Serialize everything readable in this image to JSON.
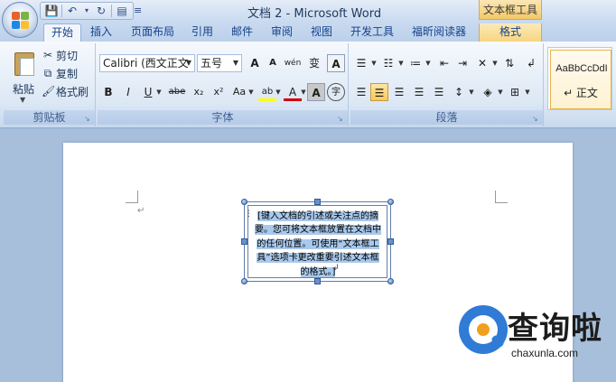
{
  "window": {
    "title": "文档 2 - Microsoft Word",
    "context_tool_title": "文本框工具"
  },
  "quick_access": {
    "save_icon": "save-icon",
    "undo_icon": "undo-icon",
    "redo_icon": "redo-icon",
    "print_icon": "print-preview-icon",
    "customize_icon": "chevron-down-icon"
  },
  "tabs": [
    "开始",
    "插入",
    "页面布局",
    "引用",
    "邮件",
    "审阅",
    "视图",
    "开发工具",
    "福昕阅读器",
    "格式"
  ],
  "clipboard": {
    "paste_label": "粘贴",
    "cut_label": "剪切",
    "copy_label": "复制",
    "format_painter_label": "格式刷",
    "group_label": "剪贴板"
  },
  "font": {
    "font_name": "Calibri (西文正文",
    "font_size": "五号",
    "grow_label": "A",
    "shrink_label": "A",
    "clear_label": "wén",
    "phonetic_label": "变",
    "border_label": "A",
    "bold": "B",
    "italic": "I",
    "underline": "U",
    "strike": "abe",
    "subscript": "x₂",
    "superscript": "x²",
    "change_case": "Aa",
    "highlight": "ab",
    "font_color": "A",
    "shading": "A",
    "enclose": "字",
    "group_label": "字体"
  },
  "paragraph": {
    "group_label": "段落"
  },
  "styles": {
    "sample": "AaBbCcDdI",
    "name": "↵ 正文"
  },
  "document": {
    "paragraph_mark": "↵",
    "textbox_text": "[键入文档的引述或关注点的摘要。您可将文本框放置在文档中的任何位置。可使用“文本框工具”选项卡更改重要引述文本框的格式。]"
  },
  "watermark": {
    "text": "查询啦",
    "url": "chaxunla.com"
  },
  "colors": {
    "accent_selected": "#f9c85b",
    "text_selection": "#a9c9ec",
    "ribbon_blue": "#dde8f5"
  }
}
